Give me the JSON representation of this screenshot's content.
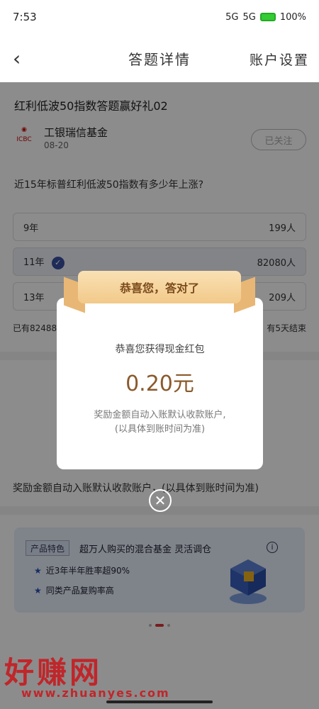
{
  "status_bar": {
    "time": "7:53",
    "signal_1": "5G",
    "signal_2": "5G",
    "battery": "100%"
  },
  "nav": {
    "back_icon": "chevron-left-icon",
    "title": "答题详情",
    "settings": "账户设置"
  },
  "quiz": {
    "title": "红利低波50指数答题赢好礼02",
    "fund_logo_text": "ICBC 工银瑞信",
    "fund_name": "工银瑞信基金",
    "fund_date": "08-20",
    "follow_label": "已关注",
    "question": "近15年标普红利低波50指数有多少年上涨?",
    "options": [
      {
        "label": "9年",
        "count": "199人",
        "selected": false
      },
      {
        "label": "11年",
        "count": "82080人",
        "selected": true
      },
      {
        "label": "13年",
        "count": "209人",
        "selected": false
      }
    ],
    "stat_left": "已有82488",
    "stat_right": "有5天结束",
    "bottom_note": "奖励金额自动入账默认收款账户，(以具体到账时间为准)"
  },
  "product": {
    "tag": "产品特色",
    "headline": "超万人购买的混合基金  灵活调仓",
    "items": [
      "近3年半年胜率超90%",
      "同类产品复购率高"
    ]
  },
  "modal": {
    "banner": "恭喜您，答对了",
    "subtitle": "恭喜您获得现金红包",
    "amount": "0.20元",
    "note_line1": "奖励金额自动入账默认收款账户,",
    "note_line2": "(以具体到账时间为准)",
    "close_icon": "close-icon"
  },
  "watermark": {
    "text": "好赚网",
    "url": "www.zhuanyes.com"
  }
}
